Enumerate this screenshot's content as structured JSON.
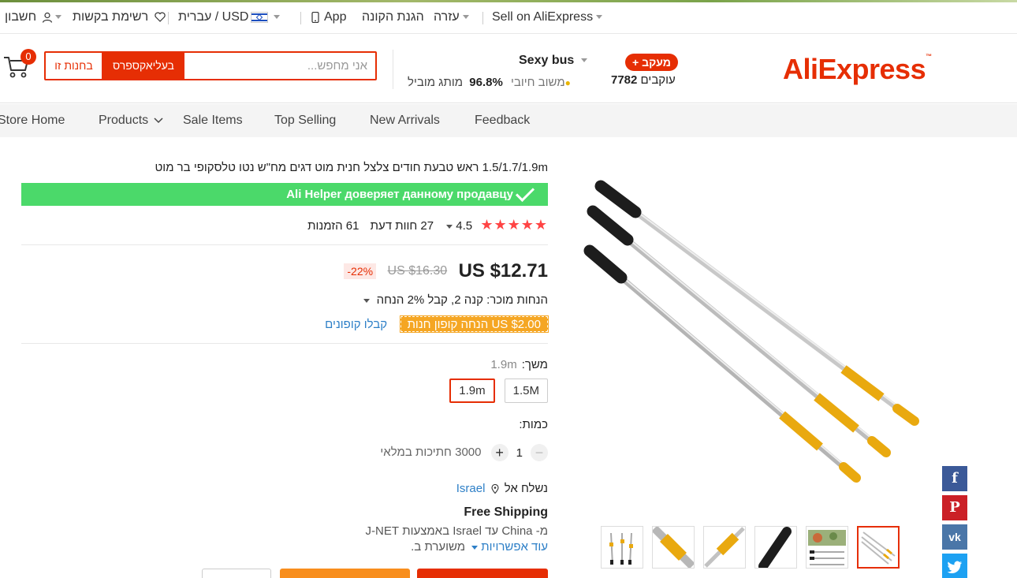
{
  "topbar": {
    "sell": "Sell on AliExpress",
    "help": "עזרה",
    "buyer_protection": "הגנת הקונה",
    "app": "App",
    "language_currency": "עברית / USD",
    "wishlist": "רשימת בקשות",
    "account": "חשבון"
  },
  "header": {
    "logo": "AliExpress",
    "follow_button": "+ מעקב",
    "followers_count": "7782",
    "followers_label": "עוקבים",
    "store_name": "Sexy bus",
    "top_brand": "מותג מוביל",
    "feedback_percent": "96.8%",
    "feedback_label": "משוב חיובי",
    "search_placeholder": "אני מחפש...",
    "search_all_button": "בעליאקספרס",
    "search_store_button": "בחנות זו",
    "cart_count": "0"
  },
  "nav": {
    "items": [
      "Store Home",
      "Products",
      "Sale Items",
      "Top Selling",
      "New Arrivals",
      "Feedback"
    ]
  },
  "product": {
    "title": "1.5/1.7/1.9m ראש טבעת חודים צלצל חנית מוט דגים מח\"ש נטו טלסקופי בר מוט",
    "helper_banner": "Ali Helper доверяет данному продавцу",
    "rating": "4.5",
    "reviews": "27",
    "reviews_label": "חוות דעת",
    "orders": "61",
    "orders_label": "הזמנות",
    "price": "US $12.71",
    "original_price": "US $16.30",
    "discount": "-22%",
    "seller_discount": "הנחות מוכר: קנה 2, קבל 2% הנחה",
    "coupon": "US $2.00 הנחה קופון חנות",
    "coupon_link": "קבלו קופונים",
    "length_label": "משך:",
    "length_selected": "1.9m",
    "options": [
      "1.5M",
      "1.9m"
    ],
    "quantity_label": "כמות:",
    "quantity": "1",
    "stock": "3000 חתיכות במלאי",
    "ship_to_label": "נשלח אל",
    "ship_to_country": "Israel",
    "free_shipping": "Free Shipping",
    "ship_line1": "מ- China עד Israel באמצעות J-NET",
    "ship_line2_text": "משוערת ב.",
    "more_options": "עוד אפשרויות"
  },
  "social": [
    "facebook-icon",
    "pinterest-icon",
    "vk-icon",
    "twitter-icon"
  ],
  "colors": {
    "brand": "#e62e04",
    "helper_green": "#4bd96a",
    "coupon_orange": "#f5a623",
    "link_blue": "#2d7fc7"
  }
}
